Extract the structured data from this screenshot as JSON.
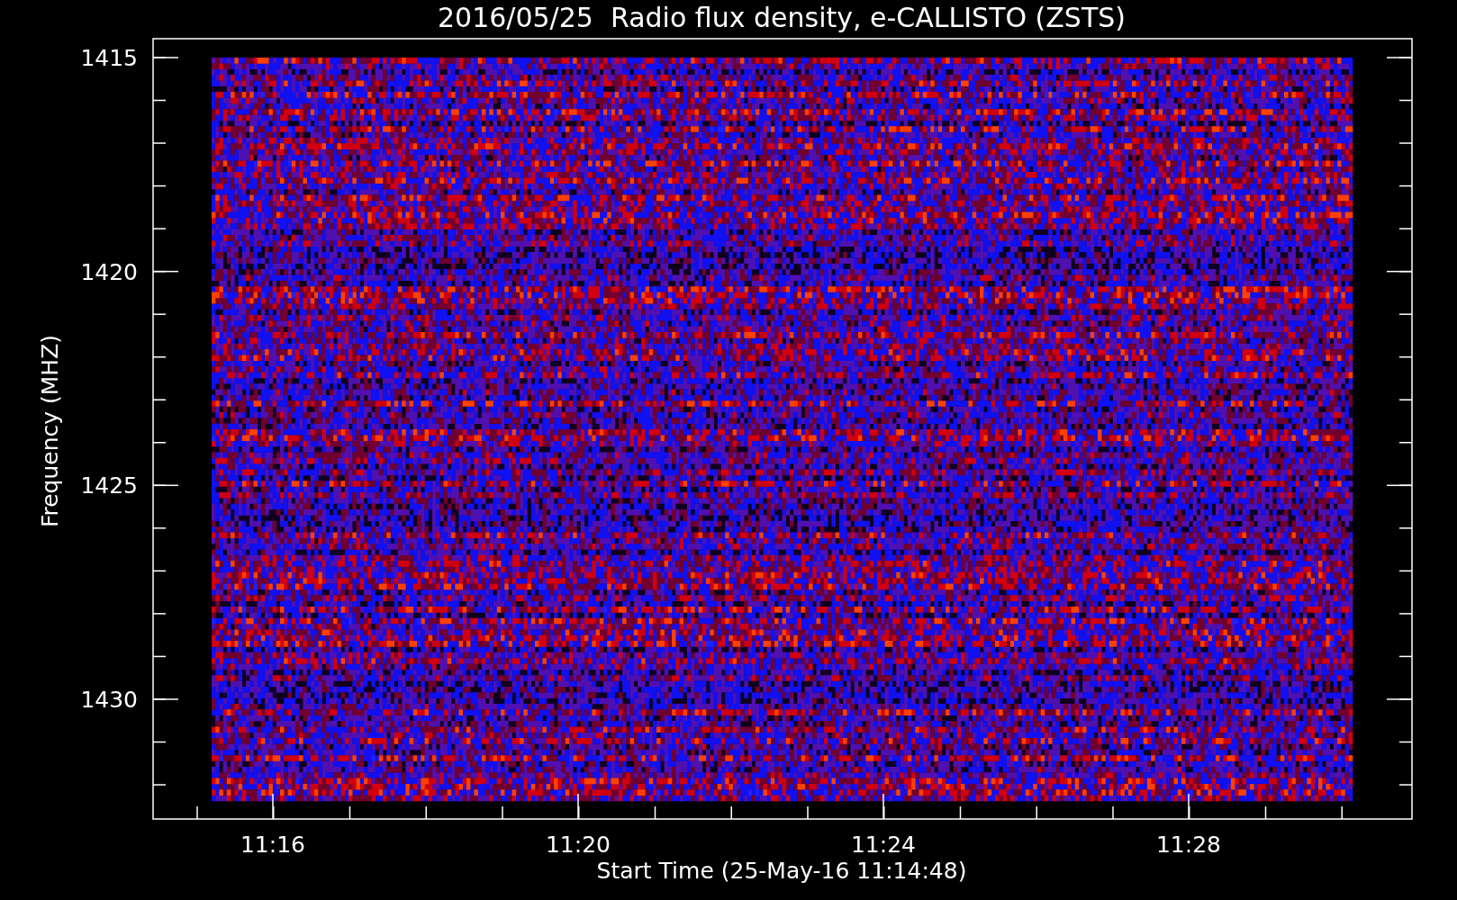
{
  "title": "2016/05/25  Radio flux density, e-CALLISTO (ZSTS)",
  "y_axis": {
    "label": "Frequency (MHZ)",
    "ticks": [
      "1415",
      "1420",
      "1425",
      "1430"
    ]
  },
  "x_axis": {
    "label": "Start Time (25-May-16 11:14:48)",
    "ticks": [
      "11:16",
      "11:20",
      "11:24",
      "11:28"
    ]
  }
}
